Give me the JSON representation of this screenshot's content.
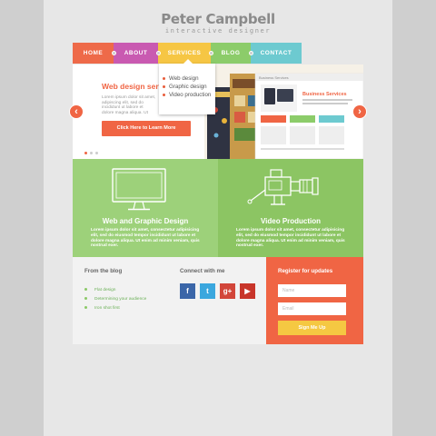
{
  "logo": {
    "name": "Peter Campbell",
    "tagline": "interactive designer"
  },
  "nav": [
    {
      "label": "HOME",
      "color": "#ee6a49"
    },
    {
      "label": "ABOUT",
      "color": "#c95ab1"
    },
    {
      "label": "SERVICES",
      "color": "#f6c644"
    },
    {
      "label": "BLOG",
      "color": "#8ccc6a"
    },
    {
      "label": "CONTACT",
      "color": "#6dcad0"
    }
  ],
  "dropdown": {
    "items": [
      "Web design",
      "Graphic design",
      "Video production"
    ]
  },
  "slider": {
    "title": "Web design servi",
    "text": "Lorem ipsum dolor sit amet, adipiscing elit, sed do incididunt ut labore et dolore magna aliqua. Ut",
    "cta": "Click Here to Learn More",
    "prev_icon": "arrow-left-icon",
    "next_icon": "arrow-right-icon",
    "mockup_heading": "Business Services"
  },
  "services": [
    {
      "title": "Web and Graphic Design",
      "icon": "monitor-icon",
      "color": "#9dd17a",
      "text": "Lorem ipsum dolor sit amet, consectetur adipisicing elit, sed do eiusmod tempor incididunt ut labore et dolore magna aliqua. Ut enim ad minim veniam, quis nostrud exer."
    },
    {
      "title": "Video Production",
      "icon": "video-camera-icon",
      "color": "#8cc563",
      "text": "Lorem ipsum dolor sit amet, consectetur adipisicing elit, sed do eiusmod tempor incididunt ut labore et dolore magna aliqua. Ut enim ad minim veniam, quis nostrud exer."
    }
  ],
  "footer": {
    "blog_title": "From the blog",
    "blog_items": [
      "Flat design",
      "Determining your audience",
      "Iron shot first"
    ],
    "connect_title": "Connect with me",
    "socials": [
      {
        "name": "facebook-icon",
        "glyph": "f",
        "color": "#3b66a8"
      },
      {
        "name": "twitter-icon",
        "glyph": "t",
        "color": "#3ba7de"
      },
      {
        "name": "google-plus-icon",
        "glyph": "g+",
        "color": "#d2463a"
      },
      {
        "name": "youtube-icon",
        "glyph": "▶",
        "color": "#c8352a"
      }
    ],
    "register_title": "Register for updates",
    "name_placeholder": "Name",
    "email_placeholder": "Email",
    "signup": "Sign Me Up"
  }
}
